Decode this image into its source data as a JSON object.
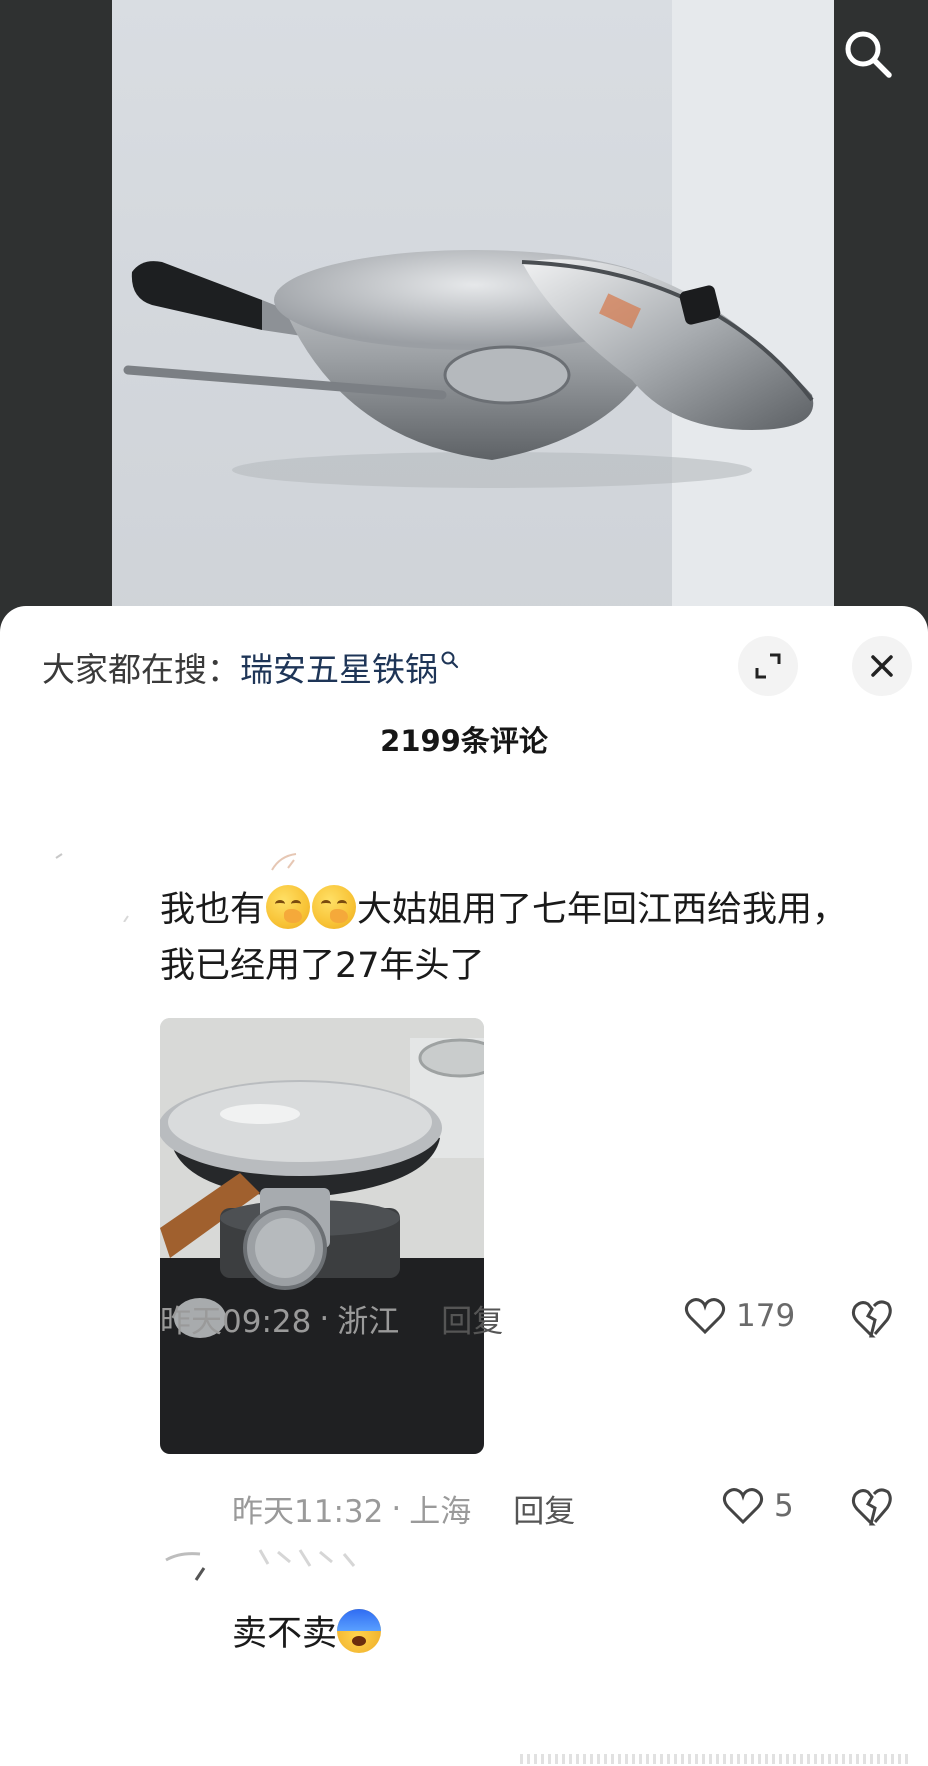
{
  "media": {
    "search_icon": "search-icon"
  },
  "hot_search": {
    "label": "大家都在搜：",
    "term": "瑞安五星铁锅",
    "term_icon": "search-icon"
  },
  "header_buttons": {
    "expand_icon": "expand-icon",
    "close_icon": "close-icon"
  },
  "comment_count": "2199条评论",
  "comments": [
    {
      "text_part1": "我也有",
      "emoji": [
        "hand-over-mouth-emoji",
        "hand-over-mouth-emoji"
      ],
      "text_part2": "大姑姐用了七年回江西给我用，我已经用了27年头了",
      "time": "昨天09:28",
      "separator": "·",
      "location": "浙江",
      "reply_label": "回复",
      "likes": "179"
    },
    {
      "text": "卖不卖",
      "emoji": "scream-emoji",
      "time": "昨天11:32",
      "separator": "·",
      "location": "上海",
      "reply_label": "回复",
      "likes": "5"
    }
  ],
  "colors": {
    "sheet_bg": "#ffffff",
    "media_bg": "#2f3131",
    "search_term": "#1e3557",
    "meta_text": "#9a9a9a"
  }
}
